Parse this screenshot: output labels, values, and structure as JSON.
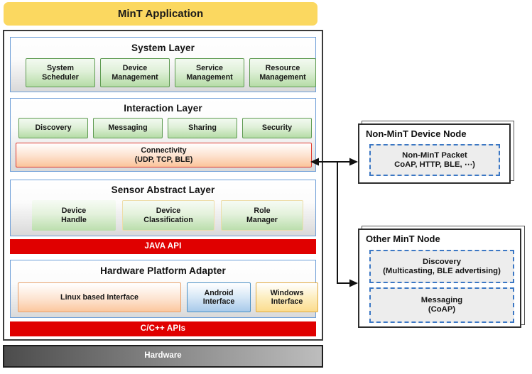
{
  "diagram": {
    "title": "MinT Application",
    "application_banner": {
      "label": "MinT Application",
      "color": "#fbd860"
    },
    "layers": [
      {
        "id": "system-layer",
        "title": "System Layer",
        "modules": [
          {
            "label": "System\nScheduler",
            "line1": "System",
            "line2": "Scheduler",
            "style": "green"
          },
          {
            "label": "Device\nManagement",
            "line1": "Device",
            "line2": "Management",
            "style": "green"
          },
          {
            "label": "Service\nManagement",
            "line1": "Service",
            "line2": "Management",
            "style": "green"
          },
          {
            "label": "Resource\nManagement",
            "line1": "Resource",
            "line2": "Management",
            "style": "green"
          }
        ]
      },
      {
        "id": "interaction-layer",
        "title": "Interaction Layer",
        "modules": [
          {
            "label": "Discovery",
            "style": "green"
          },
          {
            "label": "Messaging",
            "style": "green"
          },
          {
            "label": "Sharing",
            "style": "green"
          },
          {
            "label": "Security",
            "style": "green"
          }
        ],
        "connectivity": {
          "line1": "Connectivity",
          "line2": "(UDP, TCP, BLE)",
          "style": "peach-red-border"
        }
      },
      {
        "id": "sensor-abstract-layer",
        "title": "Sensor Abstract Layer",
        "modules": [
          {
            "line1": "Device",
            "line2": "Handle",
            "style": "green-orange-border"
          },
          {
            "line1": "Device",
            "line2": "Classification",
            "style": "green-orange-border"
          },
          {
            "line1": "Role",
            "line2": "Manager",
            "style": "green-orange-border"
          }
        ]
      },
      {
        "id": "hardware-platform-adapter",
        "title": "Hardware Platform Adapter",
        "modules": [
          {
            "line1": "Linux based Interface",
            "line2": "",
            "style": "peach"
          },
          {
            "line1": "Android",
            "line2": "Interface",
            "style": "blue"
          },
          {
            "line1": "Windows",
            "line2": "Interface",
            "style": "yellow"
          }
        ]
      }
    ],
    "api_bars": [
      {
        "id": "java-api",
        "label": "JAVA API",
        "color": "#e00000"
      },
      {
        "id": "c-cpp-apis",
        "label": "C/C++ APIs",
        "color": "#e00000"
      }
    ],
    "hardware_bar": {
      "label": "Hardware"
    },
    "nodes": [
      {
        "id": "non-mint-device-node",
        "title": "Non-MinT Device Node",
        "boxes": [
          {
            "line1": "Non-MinT Packet",
            "line2": "CoAP, HTTP, BLE, ⋯)"
          }
        ]
      },
      {
        "id": "other-mint-node",
        "title": "Other MinT Node",
        "boxes": [
          {
            "line1": "Discovery",
            "line2": "(Multicasting, BLE advertising)"
          },
          {
            "line1": "Messaging",
            "line2": "(CoAP)"
          }
        ]
      }
    ]
  }
}
